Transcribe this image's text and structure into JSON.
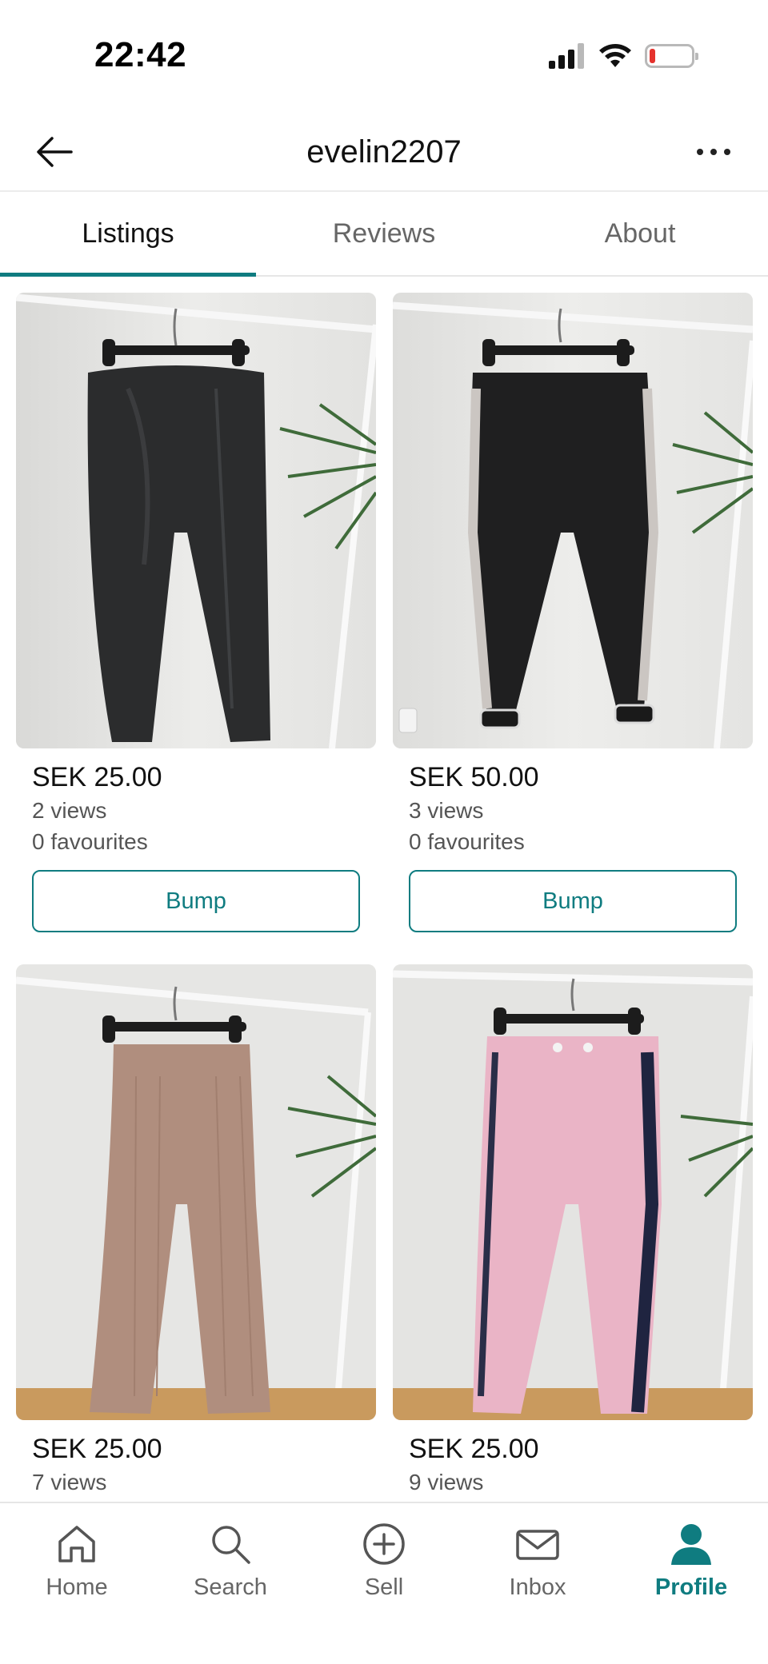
{
  "status_bar": {
    "time": "22:42"
  },
  "header": {
    "username": "evelin2207"
  },
  "tabs": [
    {
      "label": "Listings",
      "active": true
    },
    {
      "label": "Reviews",
      "active": false
    },
    {
      "label": "About",
      "active": false
    }
  ],
  "listings": [
    {
      "price": "SEK 25.00",
      "views": "2 views",
      "favourites": "0 favourites",
      "bump_label": "Bump",
      "item": "black leather-look leggings"
    },
    {
      "price": "SEK 50.00",
      "views": "3 views",
      "favourites": "0 favourites",
      "bump_label": "Bump",
      "item": "black track pants with white side stripe"
    },
    {
      "price": "SEK 25.00",
      "views": "7 views",
      "favourites": "",
      "bump_label": "",
      "item": "beige ribbed flared pants"
    },
    {
      "price": "SEK 25.00",
      "views": "9 views",
      "favourites": "",
      "bump_label": "",
      "item": "pink GANT joggers"
    }
  ],
  "colors": {
    "accent": "#0f7c80",
    "battery_low": "#e5322d"
  },
  "bottom_nav": [
    {
      "label": "Home",
      "icon": "home-icon",
      "active": false
    },
    {
      "label": "Search",
      "icon": "search-icon",
      "active": false
    },
    {
      "label": "Sell",
      "icon": "plus-circle-icon",
      "active": false
    },
    {
      "label": "Inbox",
      "icon": "mail-icon",
      "active": false
    },
    {
      "label": "Profile",
      "icon": "profile-icon",
      "active": true
    }
  ]
}
